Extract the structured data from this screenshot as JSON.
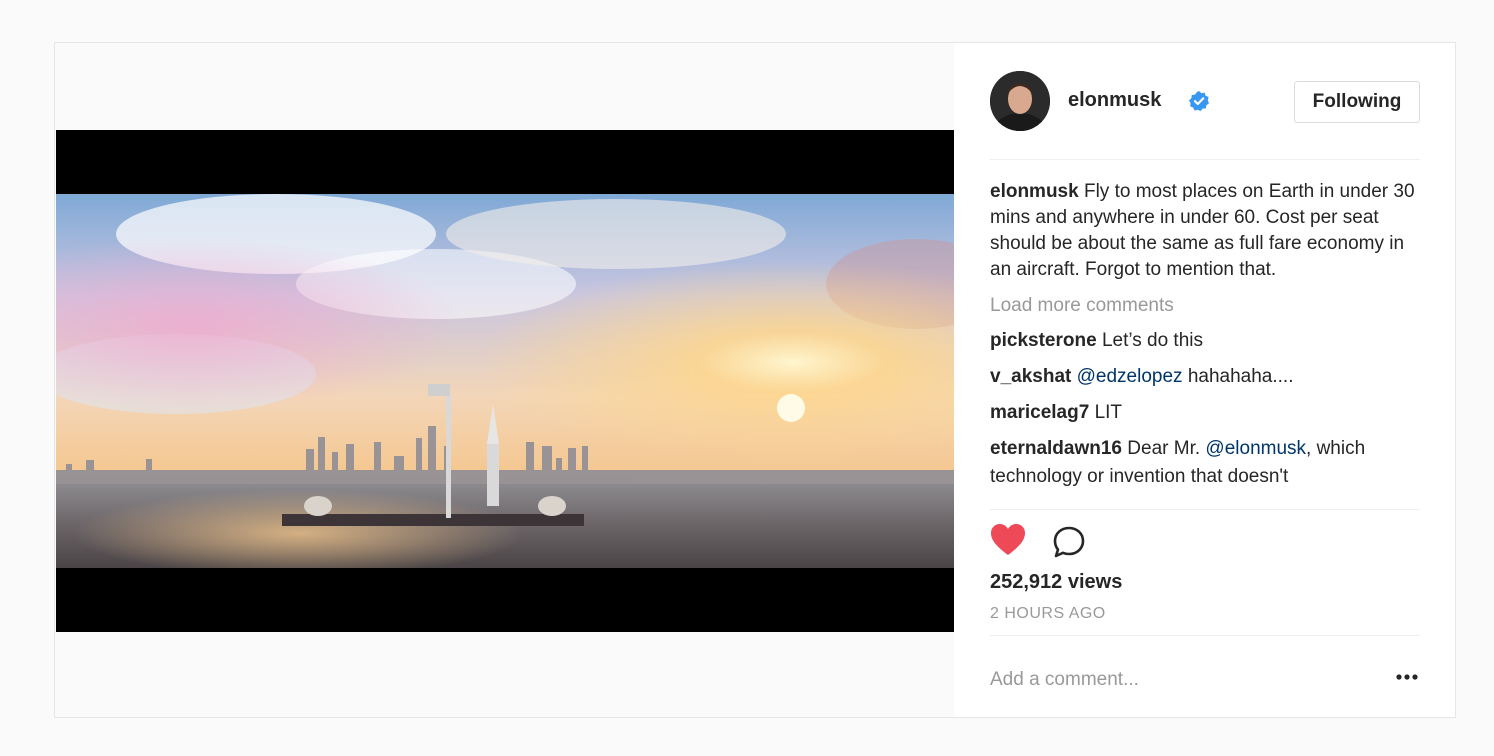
{
  "post": {
    "author": {
      "username": "elonmusk",
      "verified": true,
      "follow_label": "Following"
    },
    "caption": {
      "username": "elonmusk",
      "text": "Fly to most places on Earth in under 30 mins and anywhere in under 60. Cost per seat should be about the same as full fare economy in an aircraft. Forgot to mention that."
    },
    "load_more_label": "Load more comments",
    "comments": [
      {
        "username": "picksterone",
        "text": "Let’s do this"
      },
      {
        "username": "v_akshat",
        "mention": "@edzelopez",
        "text": "hahahaha...."
      },
      {
        "username": "maricelag7",
        "text": "LIT"
      },
      {
        "username": "eternaldawn16",
        "pre": "Dear Mr.",
        "mention": "@elonmusk",
        "text": ", which technology or invention that doesn't"
      }
    ],
    "views": "252,912 views",
    "timestamp": "2 HOURS AGO",
    "add_comment_placeholder": "Add a comment...",
    "icons": {
      "like": "heart-icon",
      "comment": "comment-bubble-icon",
      "more": "more-options-icon",
      "verified": "verified-badge-icon"
    },
    "colors": {
      "like_active": "#ed4956",
      "verified": "#3897f0",
      "mention": "#003569",
      "muted": "#999999"
    }
  }
}
